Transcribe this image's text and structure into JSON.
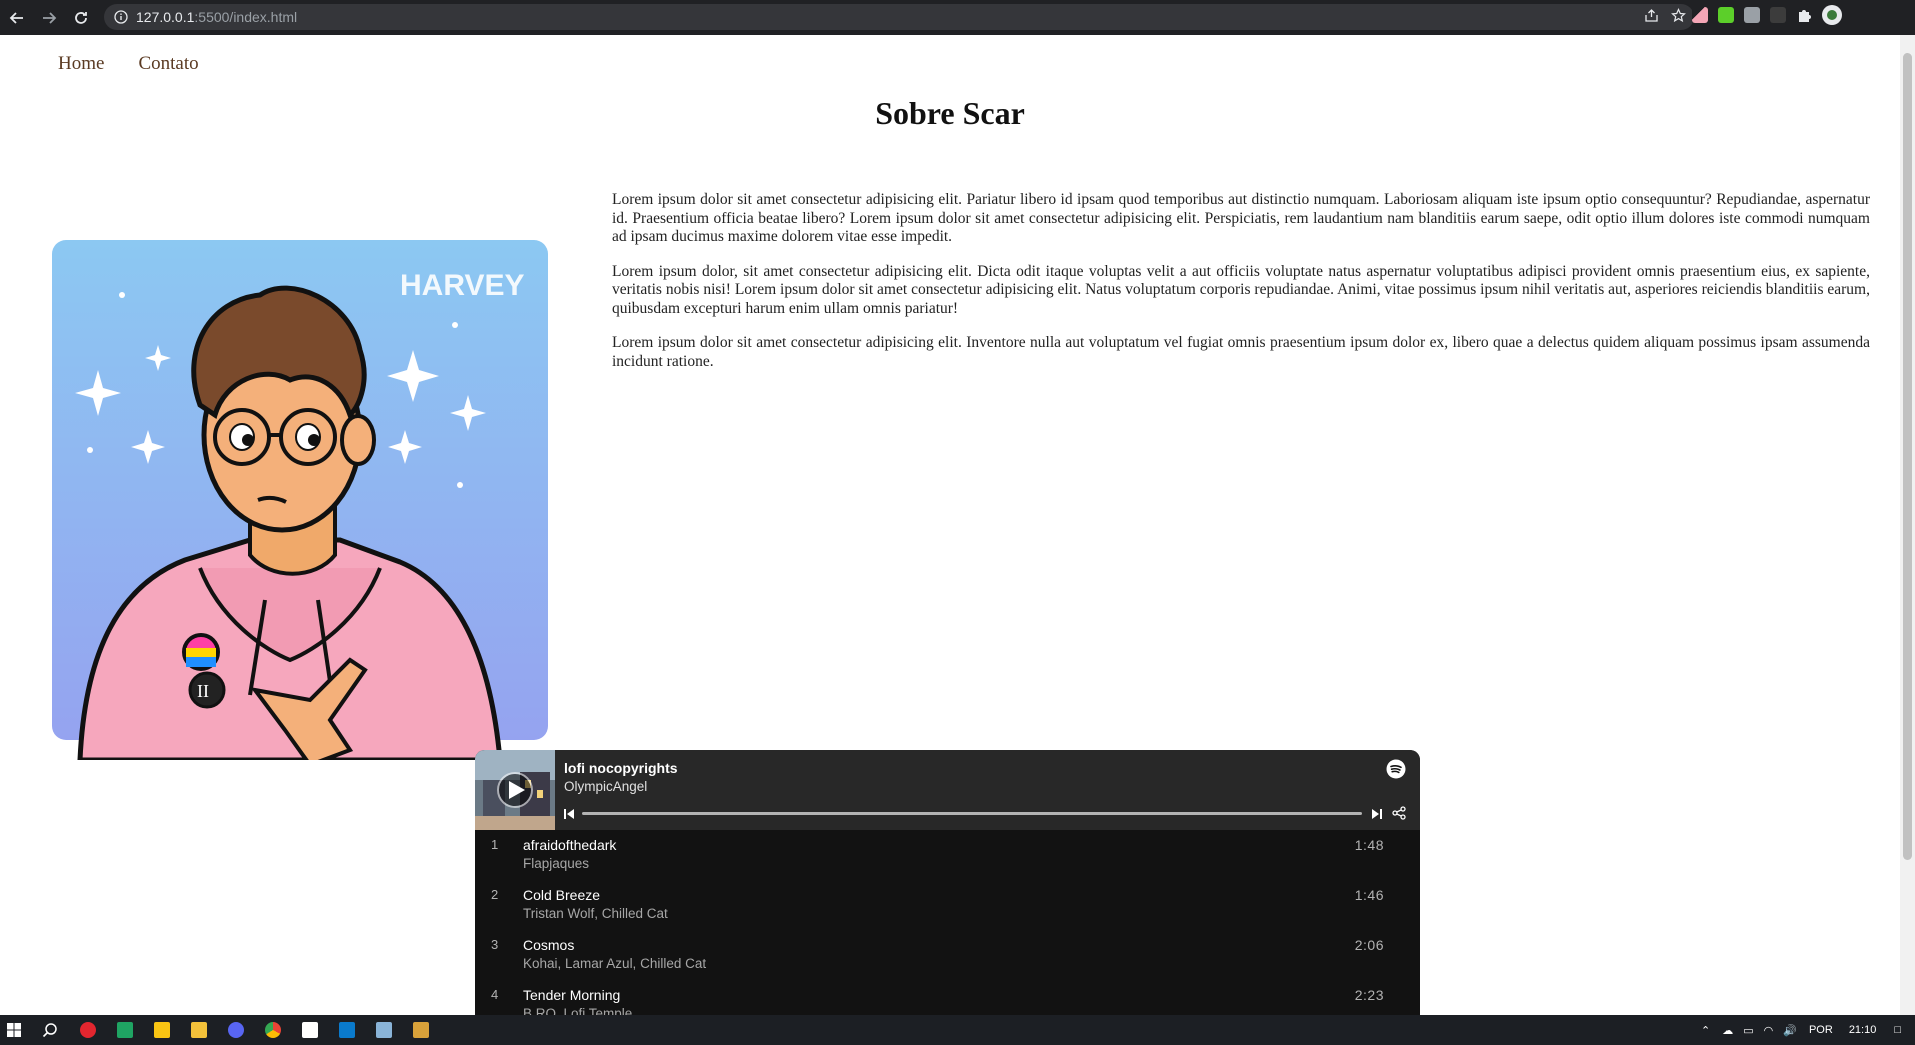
{
  "browser": {
    "url_host": "127.0.0.1",
    "url_path": ":5500/index.html"
  },
  "nav": {
    "items": [
      "Home",
      "Contato"
    ]
  },
  "page": {
    "title": "Sobre Scar",
    "portrait_signature": "HARVEY",
    "paragraphs": [
      "Lorem ipsum dolor sit amet consectetur adipisicing elit. Pariatur libero id ipsam quod temporibus aut distinctio numquam. Laboriosam aliquam iste ipsum optio consequuntur? Repudiandae, aspernatur id. Praesentium officia beatae libero? Lorem ipsum dolor sit amet consectetur adipisicing elit. Perspiciatis, rem laudantium nam blanditiis earum saepe, odit optio illum dolores iste commodi numquam ad ipsam ducimus maxime dolorem vitae esse impedit.",
      "Lorem ipsum dolor, sit amet consectetur adipisicing elit. Dicta odit itaque voluptas velit a aut officiis voluptate natus aspernatur voluptatibus adipisci provident omnis praesentium eius, ex sapiente, veritatis nobis nisi! Lorem ipsum dolor sit amet consectetur adipisicing elit. Natus voluptatum corporis repudiandae. Animi, vitae possimus ipsum nihil veritatis aut, asperiores reiciendis blanditiis earum, quibusdam excepturi harum enim ullam omnis pariatur!",
      "Lorem ipsum dolor sit amet consectetur adipisicing elit. Inventore nulla aut voluptatum vel fugiat omnis praesentium ipsum dolor ex, libero quae a delectus quidem aliquam possimus ipsam assumenda incidunt ratione."
    ]
  },
  "spotify": {
    "playlist_title": "lofi nocopyrights",
    "owner": "OlympicAngel",
    "tracks": [
      {
        "num": "1",
        "title": "afraidofthedark",
        "artist": "Flapjaques",
        "duration": "1:48"
      },
      {
        "num": "2",
        "title": "Cold Breeze",
        "artist": "Tristan Wolf, Chilled Cat",
        "duration": "1:46"
      },
      {
        "num": "3",
        "title": "Cosmos",
        "artist": "Kohai, Lamar Azul, Chilled Cat",
        "duration": "2:06"
      },
      {
        "num": "4",
        "title": "Tender Morning",
        "artist": "B.RO, Lofi Temple",
        "duration": "2:23"
      }
    ],
    "accent": "#1db954"
  },
  "taskbar": {
    "language": "POR",
    "time": "21:10"
  }
}
